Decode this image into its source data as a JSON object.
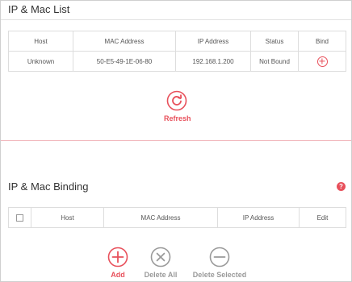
{
  "ip_mac_list": {
    "title": "IP & Mac List",
    "columns": [
      "Host",
      "MAC Address",
      "IP Address",
      "Status",
      "Bind"
    ],
    "rows": [
      {
        "host": "Unknown",
        "mac": "50-E5-49-1E-06-80",
        "ip": "192.168.1.200",
        "status": "Not Bound",
        "bind_icon": "add-circle-icon"
      }
    ],
    "refresh_label": "Refresh"
  },
  "ip_mac_binding": {
    "title": "IP & Mac Binding",
    "help_icon": "?",
    "columns": [
      "Host",
      "MAC Address",
      "IP Address",
      "Edit"
    ],
    "actions": {
      "add_label": "Add",
      "delete_all_label": "Delete All",
      "delete_selected_label": "Delete Selected"
    }
  },
  "colors": {
    "accent": "#e8505b",
    "muted_icon": "#9a9a9a",
    "border": "#dddddd"
  }
}
